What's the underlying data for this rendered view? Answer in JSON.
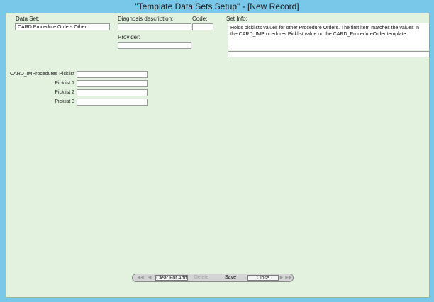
{
  "window": {
    "title": "\"Template Data Sets Setup\" - [New Record]"
  },
  "form": {
    "data_set_label": "Data Set:",
    "data_set_value": "CARD Procedure Orders Other",
    "diagnosis_label": "Diagnosis description:",
    "diagnosis_value": "",
    "code_label": "Code:",
    "code_value": "",
    "provider_label": "Provider:",
    "provider_value": "",
    "set_info_label": "Set Info:",
    "set_info_value": "Holds picklists values for other Procedure Orders.  The first item matches the values in the CARD_IMProcedures Picklist value on the CARD_ProcedureOrder template.",
    "set_info_extra_value": "",
    "picklists": [
      {
        "label": "CARD_IMProcedures Picklist",
        "value": ""
      },
      {
        "label": "Picklist 1",
        "value": ""
      },
      {
        "label": "Picklist 2",
        "value": ""
      },
      {
        "label": "Picklist 3",
        "value": ""
      }
    ]
  },
  "navbar": {
    "first_icon": "first-record-icon",
    "prev_icon": "previous-record-icon",
    "clear_label": "Clear For Add",
    "delete_label": "Delete",
    "save_label": "Save",
    "close_label": "Close",
    "next_icon": "next-record-icon",
    "last_icon": "last-record-icon"
  },
  "colors": {
    "frame": "#79c8ea",
    "client_bg": "#e2f2de"
  }
}
